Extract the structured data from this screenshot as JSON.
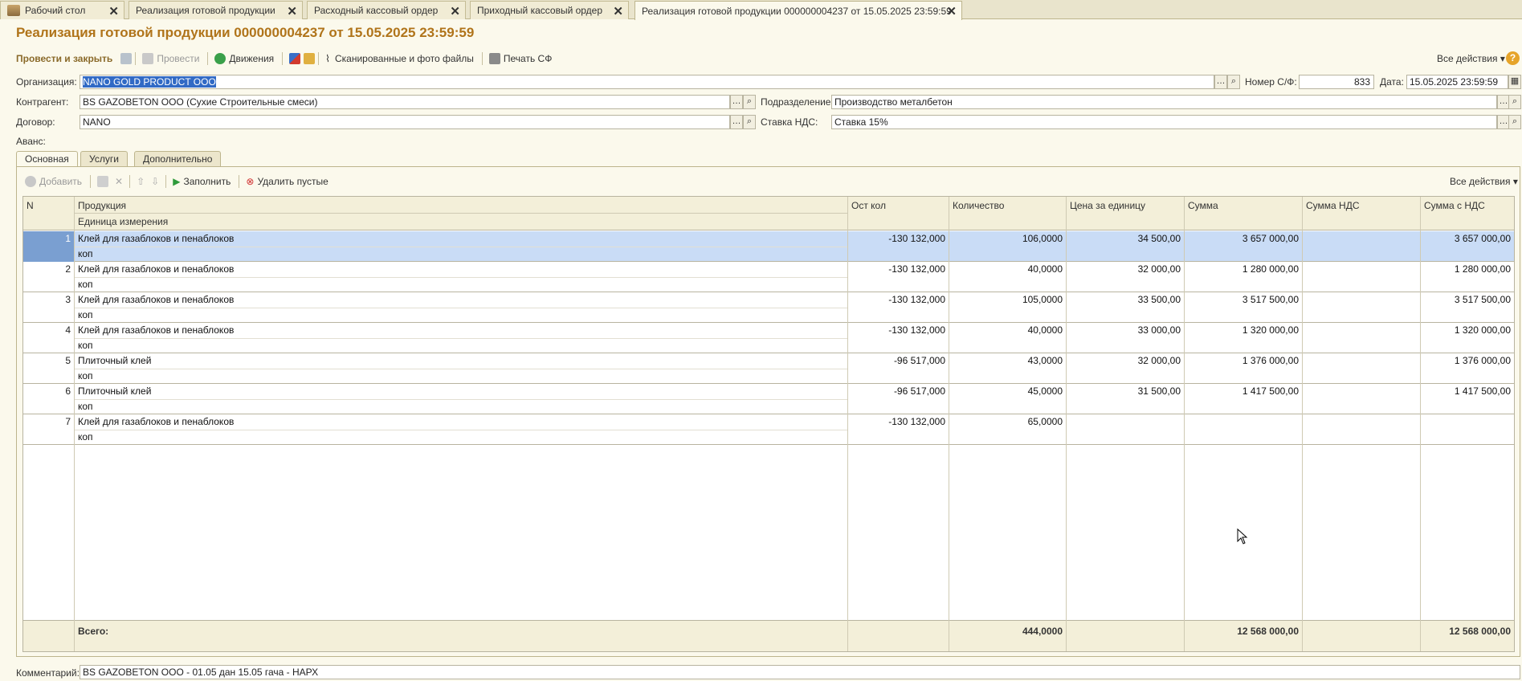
{
  "tabs": [
    {
      "label": "Рабочий стол"
    },
    {
      "label": "Реализация готовой продукции"
    },
    {
      "label": "Расходный кассовый ордер"
    },
    {
      "label": "Приходный кассовый ордер"
    },
    {
      "label": "Реализация готовой продукции 000000004237 от 15.05.2025 23:59:59"
    }
  ],
  "title": "Реализация готовой продукции 000000004237 от 15.05.2025 23:59:59",
  "toolbar": {
    "post_close": "Провести и закрыть",
    "post": "Провести",
    "movements": "Движения",
    "scanned": "Сканированные и фото файлы",
    "print_sf": "Печать СФ",
    "all_actions": "Все действия"
  },
  "form": {
    "org_label": "Организация:",
    "org_value": "NANO GOLD PRODUCT OOO",
    "sf_label": "Номер С/Ф:",
    "sf_value": "833",
    "date_label": "Дата:",
    "date_value": "15.05.2025 23:59:59",
    "counterparty_label": "Контрагент:",
    "counterparty_value": "BS GAZOBETON OOO (Сухие Строительные смеси)",
    "division_label": "Подразделение:",
    "division_value": "Производство металбетон",
    "contract_label": "Договор:",
    "contract_value": "NANO",
    "vat_label": "Ставка НДС:",
    "vat_value": "Ставка 15%",
    "advance_label": "Аванс:",
    "comment_label": "Комментарий:",
    "comment_value": "BS GAZOBETON OOO - 01.05 дан 15.05 гача - НАРХ"
  },
  "inner_tabs": [
    {
      "label": "Основная"
    },
    {
      "label": "Услуги"
    },
    {
      "label": "Дополнительно"
    }
  ],
  "table_toolbar": {
    "add": "Добавить",
    "fill": "Заполнить",
    "delete_empty": "Удалить пустые",
    "all_actions": "Все действия"
  },
  "columns": {
    "n": "N",
    "product": "Продукция",
    "unit": "Единица измерения",
    "stock": "Ост кол",
    "qty": "Количество",
    "price": "Цена за единицу",
    "sum": "Сумма",
    "vat_sum": "Сумма НДС",
    "sum_vat": "Сумма с НДС"
  },
  "rows": [
    {
      "n": "1",
      "product": "Клей для газаблоков и пенаблоков",
      "unit": "коп",
      "stock": "-130 132,000",
      "qty": "106,0000",
      "price": "34 500,00",
      "sum": "3 657 000,00",
      "vat": "",
      "total": "3 657 000,00"
    },
    {
      "n": "2",
      "product": "Клей для газаблоков и пенаблоков",
      "unit": "коп",
      "stock": "-130 132,000",
      "qty": "40,0000",
      "price": "32 000,00",
      "sum": "1 280 000,00",
      "vat": "",
      "total": "1 280 000,00"
    },
    {
      "n": "3",
      "product": "Клей для газаблоков и пенаблоков",
      "unit": "коп",
      "stock": "-130 132,000",
      "qty": "105,0000",
      "price": "33 500,00",
      "sum": "3 517 500,00",
      "vat": "",
      "total": "3 517 500,00"
    },
    {
      "n": "4",
      "product": "Клей для газаблоков и пенаблоков",
      "unit": "коп",
      "stock": "-130 132,000",
      "qty": "40,0000",
      "price": "33 000,00",
      "sum": "1 320 000,00",
      "vat": "",
      "total": "1 320 000,00"
    },
    {
      "n": "5",
      "product": "Плиточный клей",
      "unit": "коп",
      "stock": "-96 517,000",
      "qty": "43,0000",
      "price": "32 000,00",
      "sum": "1 376 000,00",
      "vat": "",
      "total": "1 376 000,00"
    },
    {
      "n": "6",
      "product": "Плиточный клей",
      "unit": "коп",
      "stock": "-96 517,000",
      "qty": "45,0000",
      "price": "31 500,00",
      "sum": "1 417 500,00",
      "vat": "",
      "total": "1 417 500,00"
    },
    {
      "n": "7",
      "product": "Клей для газаблоков и пенаблоков",
      "unit": "коп",
      "stock": "-130 132,000",
      "qty": "65,0000",
      "price": "",
      "sum": "",
      "vat": "",
      "total": ""
    }
  ],
  "totals": {
    "label": "Всего:",
    "qty": "444,0000",
    "sum": "12 568 000,00",
    "total": "12 568 000,00"
  }
}
